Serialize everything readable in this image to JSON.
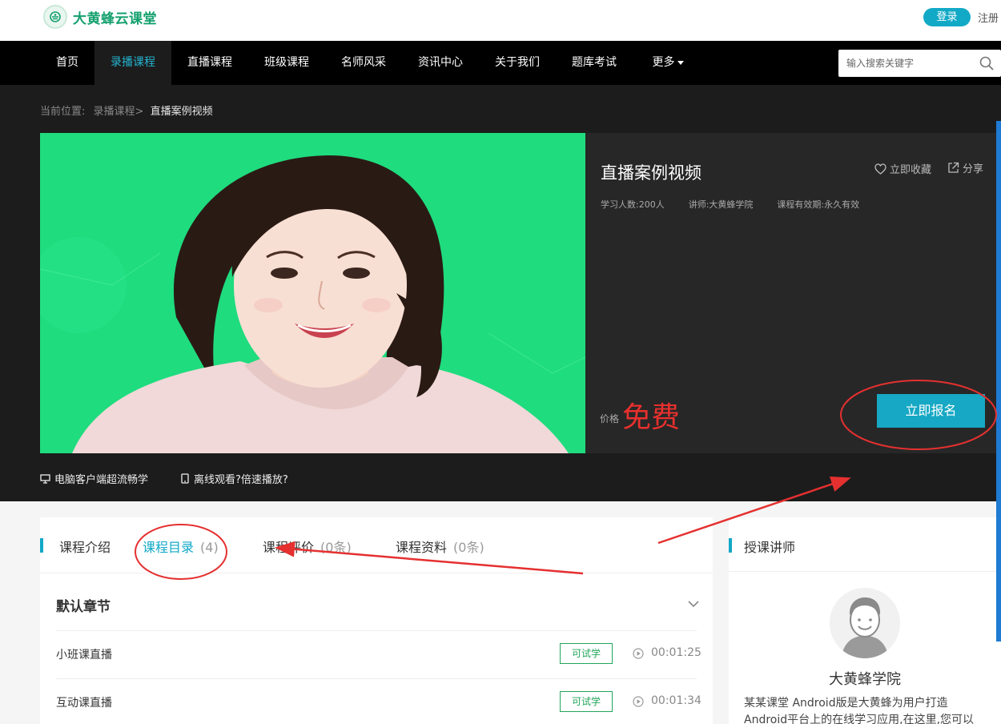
{
  "site": {
    "name": "大黄蜂云课堂",
    "login": "登录",
    "register": "注册"
  },
  "nav": {
    "items": [
      "首页",
      "录播课程",
      "直播课程",
      "班级课程",
      "名师风采",
      "资讯中心",
      "关于我们",
      "题库考试",
      "更多"
    ],
    "active": "录播课程",
    "search_placeholder": "输入搜索关键字"
  },
  "breadcrumb": {
    "prefix": "当前位置:",
    "parent": "录播课程>",
    "current": "直播案例视频"
  },
  "course": {
    "title": "直播案例视频",
    "favorite": "立即收藏",
    "share": "分享",
    "students": "学习人数:200人",
    "teacher": "讲师:大黄蜂学院",
    "validity": "课程有效期:永久有效",
    "price_label": "价格",
    "price_value": "免费",
    "enroll": "立即报名"
  },
  "features": {
    "pc_client": "电脑客户端超流畅学",
    "offline": "离线观看?倍速播放?"
  },
  "tabs": [
    {
      "label": "课程介绍",
      "count": ""
    },
    {
      "label": "课程目录",
      "count": "(4)"
    },
    {
      "label": "课程评价",
      "count": "(0条)"
    },
    {
      "label": "课程资料",
      "count": "(0条)"
    }
  ],
  "chapter": {
    "title": "默认章节",
    "lessons": [
      {
        "name": "小班课直播",
        "tag": "可试学",
        "duration": "00:01:25"
      },
      {
        "name": "互动课直播",
        "tag": "可试学",
        "duration": "00:01:34"
      }
    ]
  },
  "instructor": {
    "section_title": "授课讲师",
    "name": "大黄蜂学院",
    "description": "某某课堂 Android版是大黄蜂为用户打造 Android平台上的在线学习应用,在这里,您可以"
  },
  "colors": {
    "accent": "#12a9c6",
    "price": "#e8302d",
    "annotation": "#e53030",
    "cover_bg": "#1fdc7e",
    "trial": "#22a65b"
  }
}
